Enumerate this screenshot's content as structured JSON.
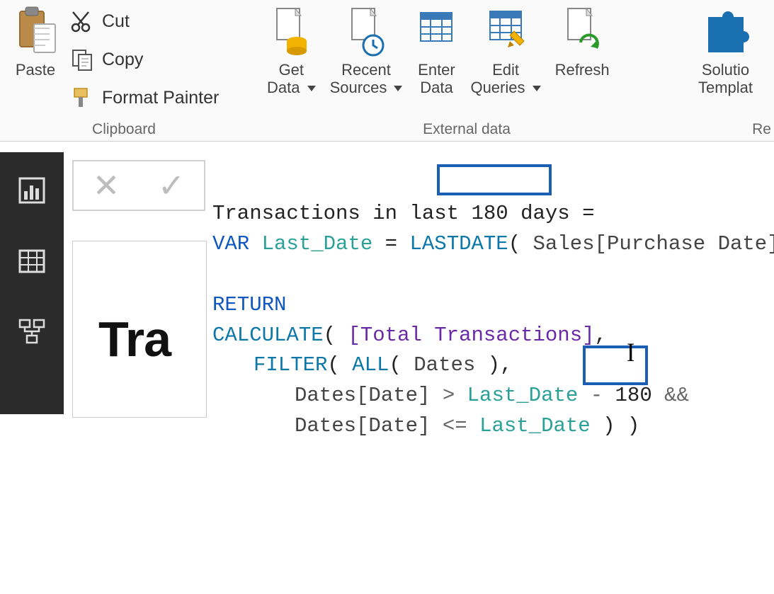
{
  "ribbon": {
    "clipboard_group_label": "Clipboard",
    "external_group_label": "External data",
    "re_group_label": "Re",
    "paste_label": "Paste",
    "cut_label": "Cut",
    "copy_label": "Copy",
    "format_painter_label": "Format Painter",
    "get_data_label": "Get\nData",
    "recent_sources_label": "Recent\nSources",
    "enter_data_label": "Enter\nData",
    "edit_queries_label": "Edit\nQueries",
    "refresh_label": "Refresh",
    "solution_templates_label": "Solutio\nTemplat"
  },
  "formula": {
    "line1_a": "Transactions in last",
    "line1_b": " 180 days ",
    "line1_c": "=",
    "var_kw": "VAR",
    "var_name": "Last_Date",
    "eq": " = ",
    "lastdate_fn": "LASTDATE",
    "lastdate_arg_open": "( ",
    "lastdate_arg": "Sales[Purchase Date]",
    "lastdate_arg_close": " )",
    "return_kw": "RETURN",
    "calc_fn": "CALCULATE",
    "calc_open": "( ",
    "measure_ref": "[Total Transactions]",
    "comma": ",",
    "filter_fn": "FILTER",
    "filter_open": "( ",
    "all_fn": "ALL",
    "all_arg_open": "( ",
    "all_arg": "Dates",
    "all_arg_close": " ),",
    "dates_col": "Dates[Date]",
    "gt": " > ",
    "minus": " - ",
    "days_num": "180",
    "and_op": " &&",
    "lte": " <= ",
    "close_parens": " ) )"
  },
  "canvas": {
    "title_fragment": "Tra"
  },
  "fx": {
    "cancel": "✕",
    "commit": "✓"
  }
}
